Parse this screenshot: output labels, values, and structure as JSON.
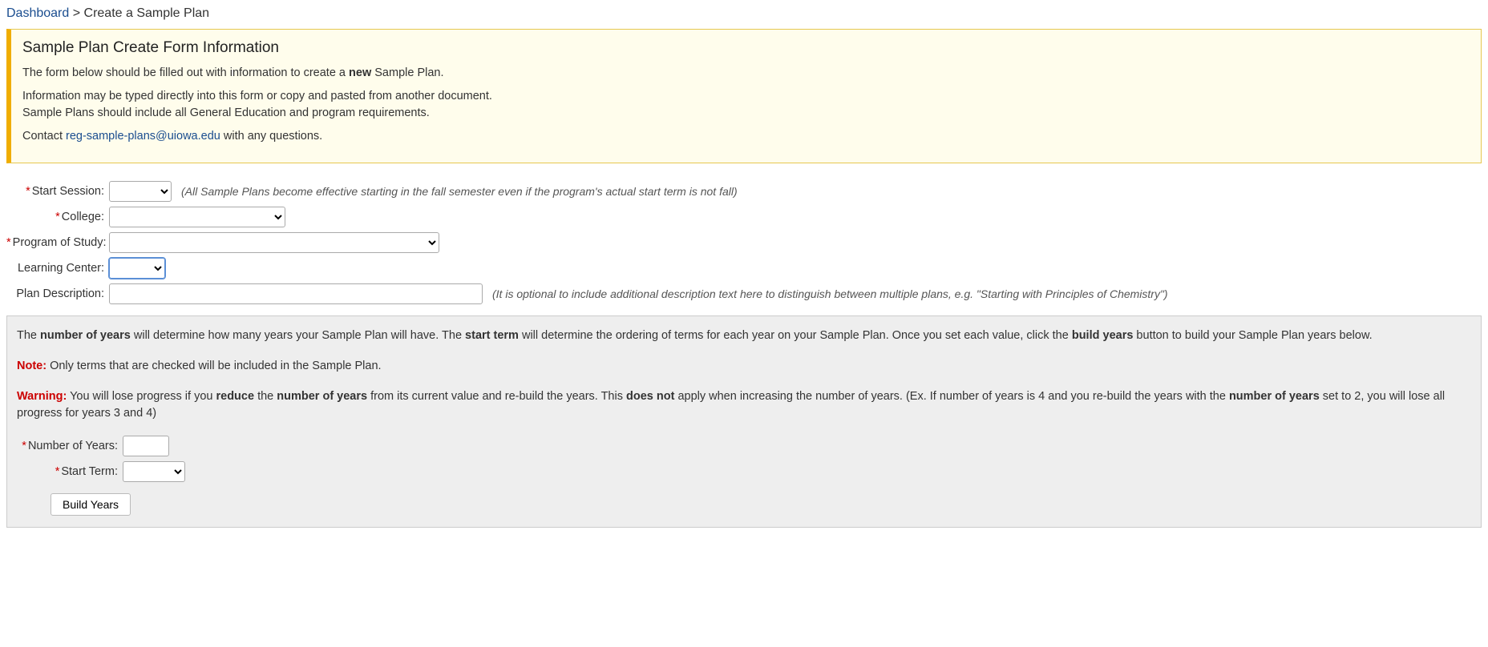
{
  "breadcrumb": {
    "dashboard": "Dashboard",
    "sep": " > ",
    "current": "Create a Sample Plan"
  },
  "info": {
    "heading": "Sample Plan Create Form Information",
    "line1_pre": "The form below should be filled out with information to create a ",
    "line1_bold": "new",
    "line1_post": " Sample Plan.",
    "line2": "Information may be typed directly into this form or copy and pasted from another document.",
    "line3": "Sample Plans should include all General Education and program requirements.",
    "contact_pre": "Contact ",
    "contact_link": "reg-sample-plans@uiowa.edu",
    "contact_post": " with any questions."
  },
  "form": {
    "start_session_label": "Start Session:",
    "start_session_hint": "(All Sample Plans become effective starting in the fall semester even if the program's actual start term is not fall)",
    "college_label": "College:",
    "program_label": "Program of Study:",
    "learning_center_label": "Learning Center:",
    "plan_desc_label": "Plan Description:",
    "plan_desc_hint": "(It is optional to include additional description text here to distinguish between multiple plans, e.g. \"Starting with Principles of Chemistry\")"
  },
  "gray": {
    "p1_a": "The ",
    "p1_b": "number of years",
    "p1_c": " will determine how many years your Sample Plan will have. The ",
    "p1_d": "start term",
    "p1_e": " will determine the ordering of terms for each year on your Sample Plan. Once you set each value, click the ",
    "p1_f": "build years",
    "p1_g": " button to build your Sample Plan years below.",
    "note_label": "Note:",
    "note_text": " Only terms that are checked will be included in the Sample Plan.",
    "warn_label": "Warning:",
    "warn_a": " You will lose progress if you ",
    "warn_b": "reduce",
    "warn_c": " the ",
    "warn_d": "number of years",
    "warn_e": " from its current value and re-build the years. This ",
    "warn_f": "does not",
    "warn_g": " apply when increasing the number of years. (Ex. If number of years is 4 and you re-build the years with the ",
    "warn_h": "number of years",
    "warn_i": " set to 2, you will lose all progress for years 3 and 4)",
    "num_years_label": "Number of Years:",
    "start_term_label": "Start Term:",
    "build_btn": "Build Years"
  }
}
